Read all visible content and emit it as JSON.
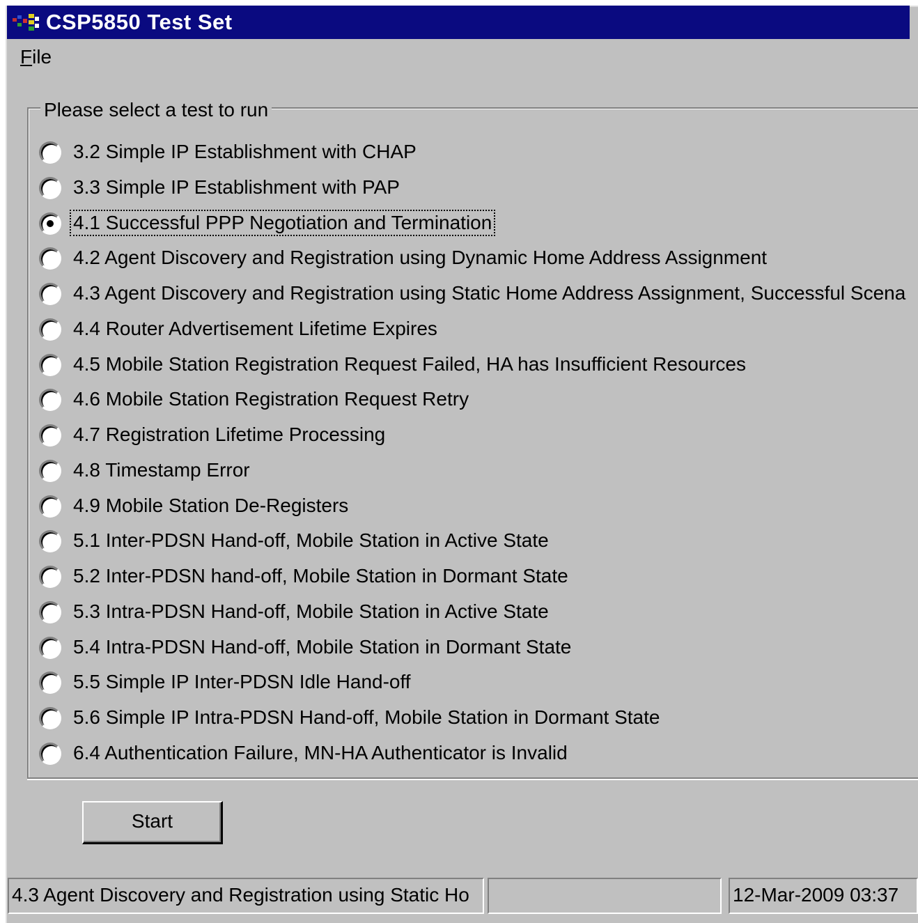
{
  "window": {
    "title": "CSP5850 Test Set"
  },
  "menu": {
    "file_mnemonic": "F",
    "file_rest": "ile"
  },
  "group": {
    "legend": "Please select a test to run",
    "selected_index": 2,
    "options": [
      "3.2 Simple IP Establishment with CHAP",
      "3.3 Simple IP Establishment with PAP",
      "4.1 Successful PPP Negotiation and Termination",
      "4.2 Agent Discovery and Registration using Dynamic Home Address Assignment",
      "4.3 Agent Discovery and Registration using Static Home Address Assignment, Successful Scena",
      "4.4 Router Advertisement Lifetime Expires",
      "4.5 Mobile Station Registration Request Failed, HA has Insufficient Resources",
      "4.6 Mobile Station Registration Request Retry",
      "4.7 Registration Lifetime Processing",
      "4.8 Timestamp Error",
      "4.9 Mobile Station De-Registers",
      "5.1 Inter-PDSN Hand-off, Mobile Station in Active State",
      "5.2 Inter-PDSN hand-off, Mobile Station in Dormant State",
      "5.3 Intra-PDSN Hand-off, Mobile Station in Active State",
      "5.4 Intra-PDSN Hand-off, Mobile Station in Dormant State",
      "5.5 Simple IP Inter-PDSN Idle Hand-off",
      "5.6 Simple IP Intra-PDSN Hand-off, Mobile Station in Dormant State",
      "6.4 Authentication Failure, MN-HA Authenticator is Invalid"
    ]
  },
  "buttons": {
    "start": "Start"
  },
  "status": {
    "panel1": "4.3 Agent Discovery and Registration using Static Ho",
    "panel2": "",
    "panel3": "12-Mar-2009   03:37"
  }
}
